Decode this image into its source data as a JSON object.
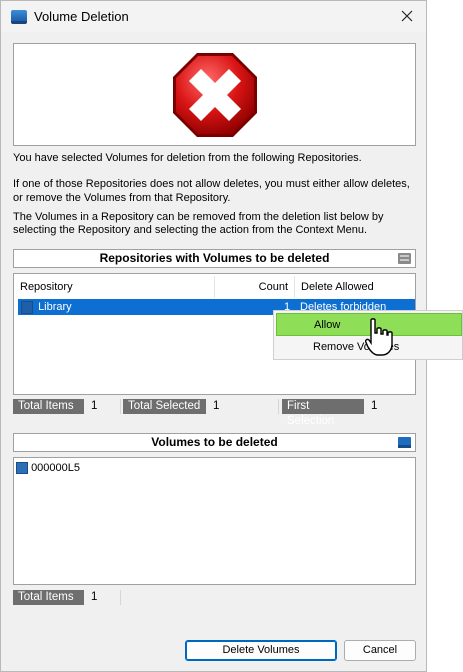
{
  "window": {
    "title": "Volume Deletion"
  },
  "message": {
    "line1": "You have selected Volumes for deletion from the following Repositories.",
    "line2a": "If one of those Repositories does not allow deletes, you must either allow deletes,",
    "line2b": "or remove the Volumes from that Repository.",
    "line3a": "The Volumes in a Repository can be removed from the deletion list below by",
    "line3b": "selecting the Repository and selecting the action from the Context Menu."
  },
  "repositories": {
    "header": "Repositories with Volumes to be deleted",
    "columns": [
      "Repository",
      "Count",
      "Delete Allowed"
    ],
    "rows": [
      {
        "name": "Library",
        "count": "1",
        "allowed": "Deletes forbidden"
      }
    ],
    "status": {
      "total_items_label": "Total Items",
      "total_items": "1",
      "total_selected_label": "Total Selected",
      "total_selected": "1",
      "first_selection_label": "First Selection",
      "first_selection": "1"
    }
  },
  "context_menu": {
    "items": [
      "Allow",
      "Remove Volumes"
    ]
  },
  "volumes": {
    "header": "Volumes to be deleted",
    "items": [
      "000000L5"
    ],
    "status": {
      "total_items_label": "Total Items",
      "total_items": "1"
    }
  },
  "buttons": {
    "delete": "Delete Volumes",
    "cancel": "Cancel"
  },
  "colors": {
    "selection": "#0d6fd1",
    "menu_highlight": "#8fde58",
    "status_label_bg": "#6e6e6e"
  }
}
